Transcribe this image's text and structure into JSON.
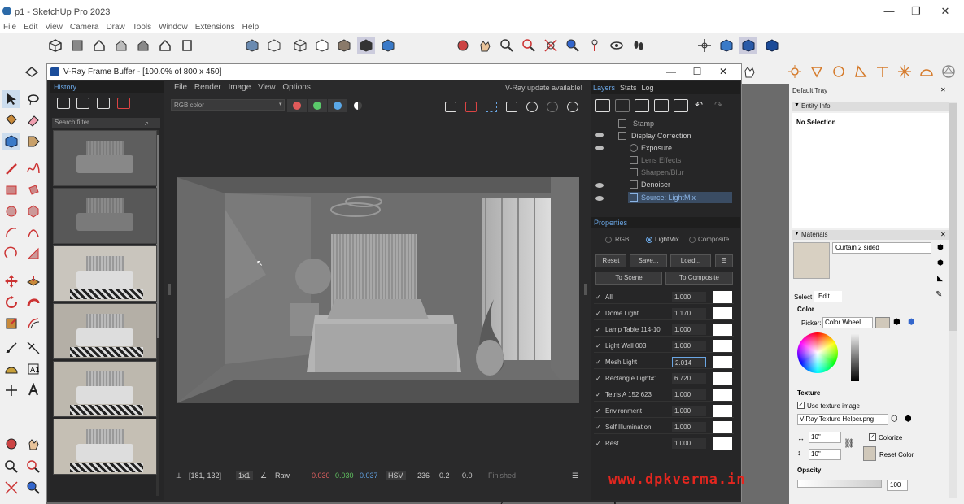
{
  "app": {
    "title": "p1 - SketchUp Pro 2023"
  },
  "menu": [
    "File",
    "Edit",
    "View",
    "Camera",
    "Draw",
    "Tools",
    "Window",
    "Extensions",
    "Help"
  ],
  "vfb": {
    "title": "V-Ray Frame Buffer - [100.0% of 800 x 450]",
    "menu": [
      "File",
      "Render",
      "Image",
      "View",
      "Options"
    ],
    "update_notice": "V-Ray update available!",
    "history_label": "History",
    "filter_placeholder": "Search filter",
    "channel": "RGB color",
    "status": {
      "coords": "[181, 132]",
      "zoom": "1x1",
      "mode": "Raw",
      "r": "0.030",
      "g": "0.030",
      "b": "0.037",
      "colorspace": "HSV",
      "h": "236",
      "s": "0.2",
      "v": "0.0",
      "state": "Finished"
    },
    "right_tabs": [
      "Layers",
      "Stats",
      "Log"
    ],
    "layers": [
      {
        "name": "Stamp",
        "enabled": false
      },
      {
        "name": "Display Correction",
        "enabled": true
      },
      {
        "name": "Exposure",
        "enabled": true
      },
      {
        "name": "Lens Effects",
        "enabled": false
      },
      {
        "name": "Sharpen/Blur",
        "enabled": false
      },
      {
        "name": "Denoiser",
        "enabled": true
      },
      {
        "name": "Source: LightMix",
        "enabled": true
      }
    ],
    "properties_label": "Properties",
    "radio": [
      "RGB",
      "LightMix",
      "Composite"
    ],
    "buttons": {
      "reset": "Reset",
      "save": "Save...",
      "load": "Load...",
      "to_scene": "To Scene",
      "to_composite": "To Composite"
    },
    "lightmix": [
      {
        "name": "All",
        "value": "1.000"
      },
      {
        "name": "Dome Light",
        "value": "1.170"
      },
      {
        "name": "Lamp Table 114-10",
        "value": "1.000"
      },
      {
        "name": "Light Wall 003",
        "value": "1.000"
      },
      {
        "name": "Mesh Light",
        "value": "2.014"
      },
      {
        "name": "Rectangle Light#1",
        "value": "6.720"
      },
      {
        "name": "Tetris A 152 623",
        "value": "1.000"
      },
      {
        "name": "Environment",
        "value": "1.000"
      },
      {
        "name": "Self Illumination",
        "value": "1.000"
      },
      {
        "name": "Rest",
        "value": "1.000"
      }
    ]
  },
  "tray": {
    "title": "Default Tray",
    "entity_info": "Entity Info",
    "no_selection": "No Selection",
    "materials": "Materials",
    "material_name": "Curtain 2 sided",
    "tabs": [
      "Select",
      "Edit"
    ],
    "color_label": "Color",
    "picker_label": "Picker:",
    "picker_value": "Color Wheel",
    "texture_label": "Texture",
    "use_texture": "Use texture image",
    "texture_file": "V-Ray Texture Helper.png",
    "width": "10\"",
    "height": "10\"",
    "colorize": "Colorize",
    "reset_color": "Reset Color",
    "opacity_label": "Opacity",
    "opacity_value": "100"
  },
  "watermark": "www.dpkverma.in"
}
